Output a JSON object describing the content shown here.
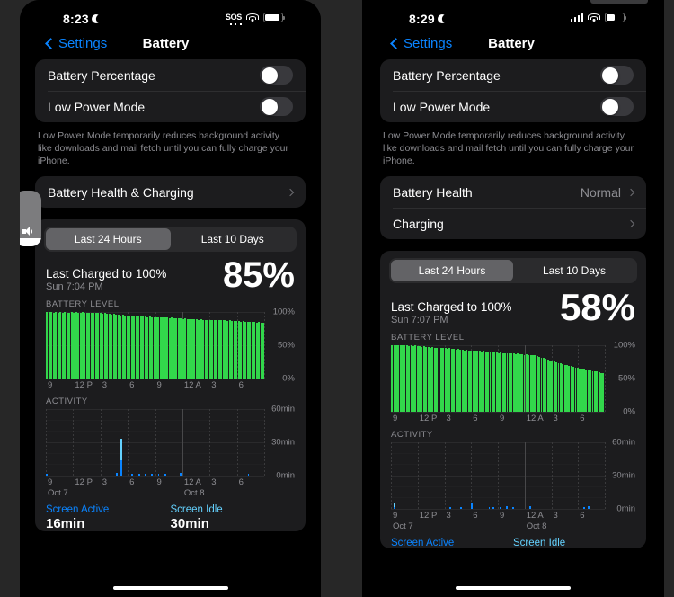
{
  "meta": {
    "accent_blue": "#0a84ff",
    "green": "#32d74b",
    "activity_blue": "#0a84ff",
    "activity_light_blue": "#64d2ff",
    "background": "#272727"
  },
  "phones": [
    {
      "id": "left",
      "status_bar": {
        "time": "8:23",
        "moon_icon": "moon-icon",
        "sos_label": "SOS",
        "wifi_icon": "wifi-icon",
        "battery_icon": "battery-icon",
        "battery_fill_percent": 88
      },
      "nav": {
        "back_label": "Settings",
        "title": "Battery"
      },
      "toggles": [
        {
          "label": "Battery Percentage",
          "on": false
        },
        {
          "label": "Low Power Mode",
          "on": false
        }
      ],
      "footnote": "Low Power Mode temporarily reduces background activity like downloads and mail fetch until you can fully charge your iPhone.",
      "links": [
        {
          "label": "Battery Health & Charging",
          "value": ""
        }
      ],
      "segmented": {
        "options": [
          "Last 24 Hours",
          "Last 10 Days"
        ],
        "selected": 0
      },
      "charged": {
        "title": "Last Charged to 100%",
        "subtitle": "Sun 7:04 PM",
        "percent": "85%"
      },
      "battery_level_label": "BATTERY LEVEL",
      "activity_label": "ACTIVITY",
      "legend": [
        {
          "name": "Screen Active",
          "value": "16min"
        },
        {
          "name": "Screen Idle",
          "value": "30min"
        }
      ],
      "chart_data": [
        {
          "type": "bar",
          "title": "BATTERY LEVEL",
          "xlabel": "",
          "ylabel": "",
          "ylim": [
            0,
            100
          ],
          "yticks": [
            0,
            50,
            100
          ],
          "ytick_labels": [
            "0%",
            "50%",
            "100%"
          ],
          "xtick_labels": [
            "9",
            "12 P",
            "3",
            "6",
            "9",
            "12 A",
            "3",
            "6"
          ],
          "date_labels": [],
          "values": [
            100,
            100,
            100,
            99,
            100,
            99,
            100,
            99,
            100,
            99,
            99,
            100,
            99,
            100,
            99,
            99,
            100,
            99,
            99,
            98,
            99,
            98,
            99,
            98,
            98,
            97,
            98,
            97,
            97,
            96,
            97,
            96,
            96,
            95,
            96,
            95,
            95,
            94,
            95,
            94,
            94,
            93,
            94,
            93,
            93,
            92,
            93,
            92,
            92,
            92,
            91,
            92,
            91,
            91,
            91,
            90,
            91,
            90,
            90,
            90,
            90,
            89,
            90,
            89,
            89,
            89,
            89,
            89,
            88,
            89,
            88,
            88,
            88,
            88,
            88,
            87,
            88,
            87,
            87,
            87,
            87,
            86,
            87,
            86,
            86,
            86,
            86,
            85,
            86,
            85,
            85,
            85,
            85,
            85,
            84,
            85,
            84,
            84
          ]
        },
        {
          "type": "bar",
          "title": "ACTIVITY",
          "xlabel": "",
          "ylabel": "",
          "ylim": [
            0,
            60
          ],
          "yticks": [
            0,
            30,
            60
          ],
          "ytick_labels": [
            "0min",
            "30min",
            "60min"
          ],
          "xtick_labels": [
            "9",
            "12 P",
            "3",
            "6",
            "9",
            "12 A",
            "3",
            "6"
          ],
          "date_labels": [
            "Oct 7",
            "Oct 8"
          ],
          "series": [
            {
              "name": "Screen Active",
              "values": [
                1.5,
                0,
                0,
                0,
                0,
                0,
                0,
                0,
                0,
                0,
                0,
                0,
                0,
                0,
                0,
                0,
                0,
                0,
                0,
                0,
                0,
                0,
                0,
                0,
                0,
                0,
                0,
                0,
                0,
                0,
                0,
                0,
                2,
                0,
                14,
                0,
                0,
                0,
                0,
                1.2,
                0,
                0,
                1.2,
                0,
                0,
                1.2,
                0,
                0,
                1.2,
                0,
                0,
                1.2,
                0,
                0,
                1.5,
                0,
                0,
                0,
                0,
                0,
                0,
                2,
                0,
                0,
                0,
                0,
                0,
                0,
                0,
                0,
                0,
                0,
                0,
                0,
                0,
                0,
                0,
                0,
                0,
                0,
                0,
                0,
                0,
                0,
                0,
                0,
                0,
                0,
                0,
                0,
                0,
                0,
                1.2,
                0,
                0,
                0,
                0,
                0,
                0
              ]
            },
            {
              "name": "Screen Idle",
              "values": [
                0,
                0,
                0,
                0,
                0,
                0,
                0,
                0,
                0,
                0,
                0,
                0,
                0,
                0,
                0,
                0,
                0,
                0,
                0,
                0,
                0,
                0,
                0,
                0,
                0,
                0,
                0,
                0,
                0,
                0,
                0,
                0,
                0,
                0,
                19,
                0,
                0,
                0,
                0,
                0,
                0,
                0,
                0,
                0,
                0,
                0,
                0,
                0,
                0,
                0,
                0,
                0,
                0,
                0,
                0,
                0,
                0,
                0,
                0,
                0,
                0,
                0,
                0,
                0,
                0,
                0,
                0,
                0,
                0,
                0,
                0,
                0,
                0,
                0,
                0,
                0,
                0,
                0,
                0,
                0,
                0,
                0,
                0,
                0,
                0,
                0,
                0,
                0,
                0,
                0,
                0,
                0,
                0,
                0,
                0,
                0,
                0,
                0,
                0,
                0
              ]
            }
          ]
        }
      ],
      "volume_hud": {
        "icon": "speaker-icon",
        "level_percent": 14
      }
    },
    {
      "id": "right",
      "status_bar": {
        "time": "8:29",
        "moon_icon": "moon-icon",
        "signal_icon": "cellular-bars-icon",
        "wifi_icon": "wifi-icon",
        "battery_icon": "battery-icon",
        "battery_fill_percent": 52
      },
      "nav": {
        "back_label": "Settings",
        "title": "Battery"
      },
      "toggles": [
        {
          "label": "Battery Percentage",
          "on": false
        },
        {
          "label": "Low Power Mode",
          "on": false
        }
      ],
      "footnote": "Low Power Mode temporarily reduces background activity like downloads and mail fetch until you can fully charge your iPhone.",
      "links": [
        {
          "label": "Battery Health",
          "value": "Normal"
        },
        {
          "label": "Charging",
          "value": ""
        }
      ],
      "segmented": {
        "options": [
          "Last 24 Hours",
          "Last 10 Days"
        ],
        "selected": 0
      },
      "charged": {
        "title": "Last Charged to 100%",
        "subtitle": "Sun 7:07 PM",
        "percent": "58%"
      },
      "battery_level_label": "BATTERY LEVEL",
      "activity_label": "ACTIVITY",
      "legend": [
        {
          "name": "Screen Active",
          "value": ""
        },
        {
          "name": "Screen Idle",
          "value": ""
        }
      ],
      "chart_data": [
        {
          "type": "bar",
          "title": "BATTERY LEVEL",
          "xlabel": "",
          "ylabel": "",
          "ylim": [
            0,
            100
          ],
          "yticks": [
            0,
            50,
            100
          ],
          "ytick_labels": [
            "0%",
            "50%",
            "100%"
          ],
          "xtick_labels": [
            "9",
            "12 P",
            "3",
            "6",
            "9",
            "12 A",
            "3",
            "6"
          ],
          "date_labels": [],
          "values": [
            99,
            100,
            99,
            100,
            99,
            100,
            99,
            99,
            98,
            99,
            98,
            99,
            98,
            98,
            97,
            98,
            97,
            97,
            96,
            97,
            96,
            96,
            95,
            96,
            95,
            95,
            94,
            95,
            94,
            94,
            93,
            94,
            93,
            93,
            92,
            93,
            92,
            92,
            91,
            92,
            91,
            91,
            90,
            91,
            90,
            90,
            89,
            90,
            89,
            89,
            88,
            89,
            88,
            88,
            87,
            88,
            87,
            87,
            86,
            87,
            86,
            86,
            85,
            86,
            85,
            85,
            84,
            84,
            83,
            82,
            81,
            80,
            79,
            78,
            77,
            76,
            75,
            74,
            73,
            72,
            71,
            70,
            70,
            69,
            68,
            67,
            66,
            66,
            65,
            64,
            64,
            63,
            62,
            62,
            61,
            60,
            60,
            59,
            58,
            58
          ]
        },
        {
          "type": "bar",
          "title": "ACTIVITY",
          "xlabel": "",
          "ylabel": "",
          "ylim": [
            0,
            60
          ],
          "yticks": [
            0,
            30,
            60
          ],
          "ytick_labels": [
            "0min",
            "30min",
            "60min"
          ],
          "xtick_labels": [
            "9",
            "12 P",
            "3",
            "6",
            "9",
            "12 A",
            "3",
            "6"
          ],
          "date_labels": [
            "Oct 7",
            "Oct 8"
          ],
          "series": [
            {
              "name": "Screen Active",
              "values": [
                0,
                1.5,
                0,
                0,
                0,
                0,
                0,
                0,
                0,
                0,
                0,
                0,
                0,
                0,
                0,
                0,
                0,
                0,
                0,
                0,
                0,
                0,
                0,
                0,
                0,
                0,
                0,
                1.2,
                0,
                0,
                0,
                0,
                1.5,
                0,
                0,
                0,
                0,
                5,
                0,
                0,
                0,
                0,
                0,
                0,
                0,
                1.2,
                0,
                1.2,
                0,
                0,
                1.5,
                0,
                0,
                2,
                0,
                0,
                1.2,
                0,
                0,
                0,
                0,
                0,
                0,
                0,
                2,
                0,
                0,
                0,
                0,
                0,
                0,
                0,
                0,
                0,
                0,
                0,
                0,
                0,
                0,
                0,
                0,
                0,
                0,
                0,
                0,
                0,
                0,
                0,
                0,
                1.5,
                0,
                2,
                0,
                0,
                0,
                0,
                0,
                0,
                0
              ]
            },
            {
              "name": "Screen Idle",
              "values": [
                0,
                3.5,
                0,
                0,
                0,
                0,
                0,
                0,
                0,
                0,
                0,
                0,
                0,
                0,
                0,
                0,
                0,
                0,
                0,
                0,
                0,
                0,
                0,
                0,
                0,
                0,
                0,
                0,
                0,
                0,
                0,
                0,
                0,
                0,
                0,
                0,
                0,
                0,
                0,
                0,
                0,
                0,
                0,
                0,
                0,
                0,
                0,
                0,
                0,
                0,
                0,
                0,
                0,
                0,
                0,
                0,
                0,
                0,
                0,
                0,
                0,
                0,
                0,
                0,
                0,
                0,
                0,
                0,
                0,
                0,
                0,
                0,
                0,
                0,
                0,
                0,
                0,
                0,
                0,
                0,
                0,
                0,
                0,
                0,
                0,
                0,
                0,
                0,
                0,
                0,
                0,
                0,
                0,
                0,
                0,
                0,
                0,
                0,
                0
              ]
            }
          ]
        }
      ]
    }
  ]
}
